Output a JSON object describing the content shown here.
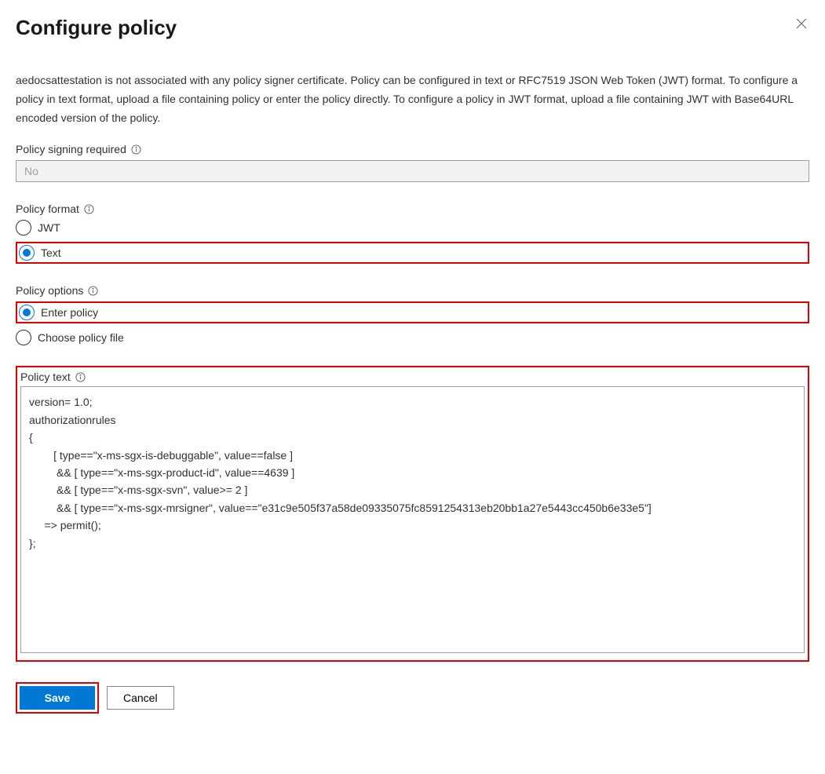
{
  "header": {
    "title": "Configure policy"
  },
  "description": "aedocsattestation is not associated with any policy signer certificate. Policy can be configured in text or RFC7519 JSON Web Token (JWT) format. To configure a policy in text format, upload a file containing policy or enter the policy directly. To configure a policy in JWT format, upload a file containing JWT with Base64URL encoded version of the policy.",
  "signing": {
    "label": "Policy signing required",
    "value": "No"
  },
  "format": {
    "label": "Policy format",
    "options": {
      "jwt": "JWT",
      "text": "Text"
    }
  },
  "policy_options": {
    "label": "Policy options",
    "options": {
      "enter": "Enter policy",
      "choose": "Choose policy file"
    }
  },
  "policy_text": {
    "label": "Policy text",
    "value": "version= 1.0;\nauthorizationrules\n{\n        [ type==\"x-ms-sgx-is-debuggable\", value==false ]\n         && [ type==\"x-ms-sgx-product-id\", value==4639 ]\n         && [ type==\"x-ms-sgx-svn\", value>= 2 ]\n         && [ type==\"x-ms-sgx-mrsigner\", value==\"e31c9e505f37a58de09335075fc8591254313eb20bb1a27e5443cc450b6e33e5\"]\n     => permit();\n};"
  },
  "buttons": {
    "save": "Save",
    "cancel": "Cancel"
  }
}
